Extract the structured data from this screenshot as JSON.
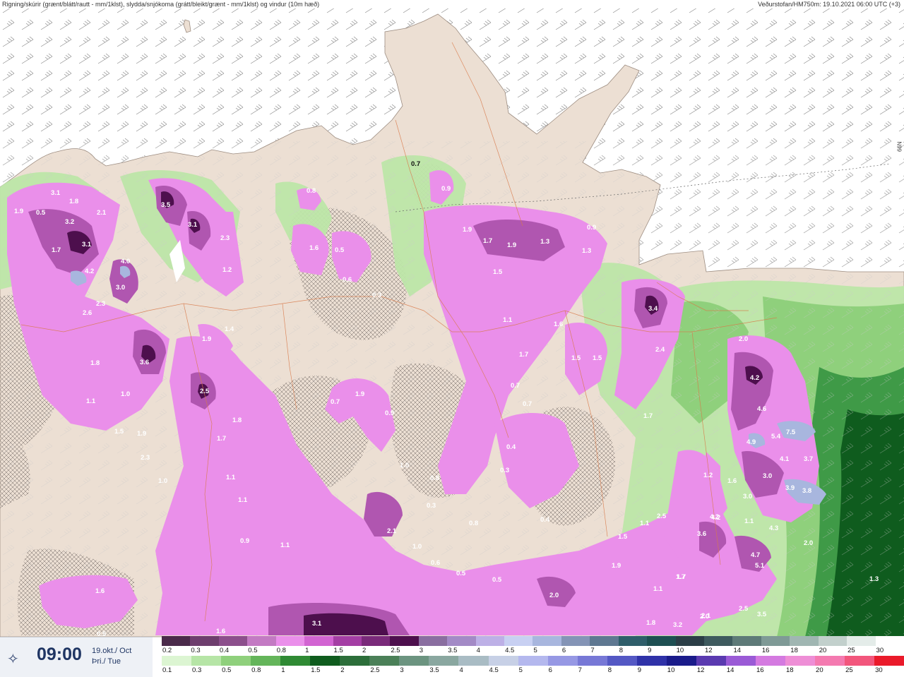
{
  "header": {
    "title": "Rigning/skúrir (grænt/blátt/rautt - mm/1klst), slydda/snjókoma (grátt/bleikt/grænt - mm/1klst) og vindur (10m hæð)",
    "source": "Veðurstofan/HM750m: 19.10.2021 06:00 UTC (+3)",
    "side": "N99"
  },
  "timebox": {
    "logo_icon": "vedurstofan-logo-icon",
    "time": "09:00",
    "date_line1": "19.okt./ Oct",
    "date_line2": "Þri./ Tue"
  },
  "scale_snow": {
    "labels": [
      "0.2",
      "0.3",
      "0.4",
      "0.5",
      "0.8",
      "1",
      "1.5",
      "2",
      "2.5",
      "3",
      "3.5",
      "4",
      "4.5",
      "5",
      "6",
      "7",
      "8",
      "9",
      "10",
      "12",
      "14",
      "16",
      "18",
      "20",
      "25",
      "30"
    ],
    "colors": [
      "#4a2a4a",
      "#6e3e6e",
      "#8c4f8c",
      "#c37ac3",
      "#ea8fea",
      "#d264d2",
      "#a43ea4",
      "#7a2a7a",
      "#4d0f4d",
      "#8a6ea0",
      "#a38ac6",
      "#bdb0e6",
      "#c8d0f2",
      "#a8b6de",
      "#8494b6",
      "#5f7891",
      "#2f5e6a",
      "#1e4f52",
      "#2b3e46",
      "#3e5a5e",
      "#5e7a78",
      "#7f9a96",
      "#a0b6b2",
      "#c2d0cc",
      "#e4ece9",
      "#ffffff"
    ]
  },
  "scale_rain": {
    "labels": [
      "0.1",
      "0.3",
      "0.5",
      "0.8",
      "1",
      "1.5",
      "2",
      "2.5",
      "3",
      "3.5",
      "4",
      "4.5",
      "5",
      "6",
      "7",
      "8",
      "9",
      "10",
      "12",
      "14",
      "16",
      "18",
      "20",
      "25",
      "30"
    ],
    "colors": [
      "#dcf5d2",
      "#b6e5a6",
      "#8fd07c",
      "#64b55a",
      "#2f8a34",
      "#0f5c1e",
      "#2c6e3a",
      "#4b8058",
      "#6c9480",
      "#8aa7a0",
      "#a9bcc4",
      "#c7d0e6",
      "#b4b8ee",
      "#9698e4",
      "#7778d6",
      "#5458c4",
      "#2f32a8",
      "#1a1b8a",
      "#5a3ab0",
      "#9a5ad6",
      "#d47ae0",
      "#ee8ed6",
      "#f47ab0",
      "#f2567c",
      "#ea1a2a"
    ]
  },
  "values": [
    {
      "v": "1.9"
    },
    {
      "v": "0.5"
    },
    {
      "v": "3.1"
    },
    {
      "v": "1.8"
    },
    {
      "v": "2.1"
    },
    {
      "v": "3.2"
    },
    {
      "v": "3.1"
    },
    {
      "v": "1.7"
    },
    {
      "v": "4.2"
    },
    {
      "v": "4.0"
    },
    {
      "v": "3.0"
    },
    {
      "v": "2.3"
    },
    {
      "v": "2.6"
    },
    {
      "v": "3.5"
    },
    {
      "v": "3.1"
    },
    {
      "v": "2.3"
    },
    {
      "v": "1.2"
    },
    {
      "v": "0.8"
    },
    {
      "v": "1.6"
    },
    {
      "v": "0.5"
    },
    {
      "v": "0.6"
    },
    {
      "v": "0.3"
    },
    {
      "v": "0.7"
    },
    {
      "v": "0.9"
    },
    {
      "v": "1.9"
    },
    {
      "v": "1.7"
    },
    {
      "v": "1.9"
    },
    {
      "v": "1.3"
    },
    {
      "v": "0.9"
    },
    {
      "v": "1.3"
    },
    {
      "v": "1.5"
    },
    {
      "v": "3.4"
    },
    {
      "v": "2.4"
    },
    {
      "v": "1.1"
    },
    {
      "v": "1.6"
    },
    {
      "v": "1.7"
    },
    {
      "v": "1.5"
    },
    {
      "v": "1.5"
    },
    {
      "v": "3.6"
    },
    {
      "v": "1.8"
    },
    {
      "v": "1.9"
    },
    {
      "v": "1.4"
    },
    {
      "v": "2.5"
    },
    {
      "v": "1.0"
    },
    {
      "v": "1.1"
    },
    {
      "v": "1.5"
    },
    {
      "v": "1.9"
    },
    {
      "v": "2.3"
    },
    {
      "v": "1.0"
    },
    {
      "v": "1.8"
    },
    {
      "v": "1.7"
    },
    {
      "v": "1.1"
    },
    {
      "v": "1.1"
    },
    {
      "v": "0.9"
    },
    {
      "v": "1.1"
    },
    {
      "v": "0.7"
    },
    {
      "v": "1.9"
    },
    {
      "v": "0.9"
    },
    {
      "v": "1.0"
    },
    {
      "v": "0.8"
    },
    {
      "v": "0.3"
    },
    {
      "v": "2.1"
    },
    {
      "v": "1.0"
    },
    {
      "v": "0.8"
    },
    {
      "v": "0.6"
    },
    {
      "v": "0.5"
    },
    {
      "v": "0.5"
    },
    {
      "v": "0.3"
    },
    {
      "v": "0.4"
    },
    {
      "v": "0.7"
    },
    {
      "v": "0.7"
    },
    {
      "v": "0.4"
    },
    {
      "v": "1.7"
    },
    {
      "v": "2.0"
    },
    {
      "v": "2.0"
    },
    {
      "v": "4.2"
    },
    {
      "v": "4.6"
    },
    {
      "v": "4.9"
    },
    {
      "v": "5.4"
    },
    {
      "v": "7.5"
    },
    {
      "v": "4.1"
    },
    {
      "v": "3.7"
    },
    {
      "v": "3.0"
    },
    {
      "v": "3.9"
    },
    {
      "v": "3.8"
    },
    {
      "v": "1.6"
    },
    {
      "v": "3.0"
    },
    {
      "v": "1.2"
    },
    {
      "v": "4.2"
    },
    {
      "v": "3.6"
    },
    {
      "v": "1.1"
    },
    {
      "v": "4.3"
    },
    {
      "v": "4.7"
    },
    {
      "v": "5.1"
    },
    {
      "v": "2.5"
    },
    {
      "v": "1.1"
    },
    {
      "v": "1.5"
    },
    {
      "v": "1.9"
    },
    {
      "v": "1.1"
    },
    {
      "v": "1.7"
    },
    {
      "v": "2.0"
    },
    {
      "v": "1.8"
    },
    {
      "v": "2.1"
    },
    {
      "v": "3.2"
    },
    {
      "v": "2.5"
    },
    {
      "v": "3.5"
    },
    {
      "v": "1.3"
    },
    {
      "v": "1.6"
    },
    {
      "v": "0.5"
    },
    {
      "v": "1.6"
    },
    {
      "v": "3.1"
    },
    {
      "v": "2.0"
    },
    {
      "v": "1.7"
    },
    {
      "v": "4.2"
    }
  ]
}
